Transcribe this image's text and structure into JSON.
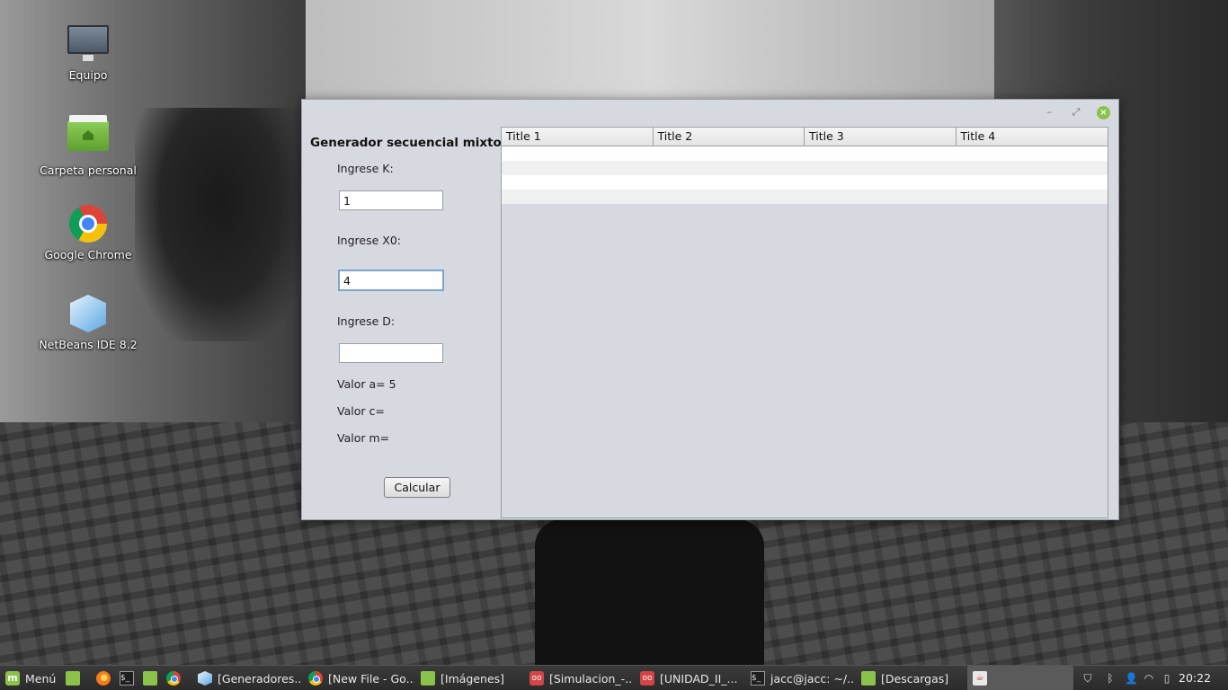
{
  "desktop": {
    "icons": [
      {
        "label": "Equipo",
        "icon": "computer-icon"
      },
      {
        "label": "Carpeta personal",
        "icon": "home-folder-icon"
      },
      {
        "label": "Google Chrome",
        "icon": "chrome-icon"
      },
      {
        "label": "NetBeans IDE 8.2",
        "icon": "netbeans-icon"
      }
    ]
  },
  "window": {
    "controls": {
      "minimize": "–",
      "maximize": "⤢",
      "close": "×"
    },
    "form": {
      "title": "Generador secuencial mixto",
      "k_label": "Ingrese K:",
      "k_value": "1",
      "x0_label": "Ingrese X0:",
      "x0_value": "4",
      "d_label": "Ingrese D:",
      "d_value": "",
      "valor_a": "Valor a= 5",
      "valor_c": "Valor c=",
      "valor_m": "Valor m=",
      "calcular_label": "Calcular"
    },
    "table": {
      "columns": [
        "Title 1",
        "Title 2",
        "Title 3",
        "Title 4"
      ],
      "row_count": 4
    }
  },
  "taskbar": {
    "menu_label": "Menú",
    "tasks": [
      {
        "label": "[Generadores...",
        "icon": "netbeans-icon"
      },
      {
        "label": "[New File - Go...",
        "icon": "chrome-icon"
      },
      {
        "label": "[Imágenes]",
        "icon": "folder-icon"
      },
      {
        "label": "[Simulacion_-...",
        "icon": "document-viewer-icon"
      },
      {
        "label": "[UNIDAD_II_...",
        "icon": "document-viewer-icon"
      },
      {
        "label": "jacc@jacc: ~/...",
        "icon": "terminal-icon"
      },
      {
        "label": "[Descargas]",
        "icon": "folder-icon"
      },
      {
        "label": "",
        "icon": "java-icon"
      }
    ],
    "clock": "20:22"
  }
}
